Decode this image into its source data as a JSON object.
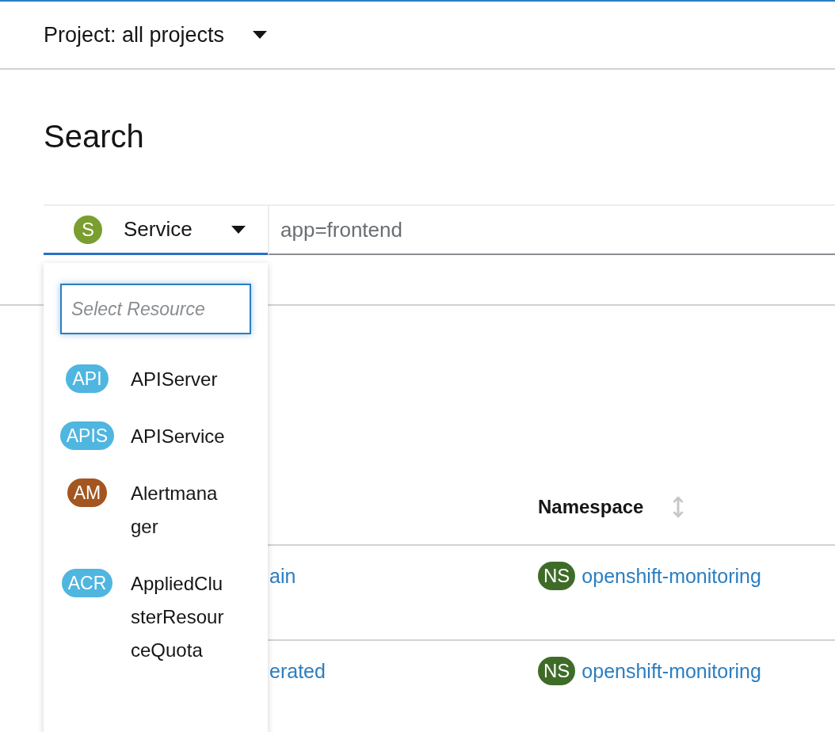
{
  "project_selector": {
    "label": "Project: all projects"
  },
  "page_title": "Search",
  "filter": {
    "resource": {
      "badge": "S",
      "label": "Service"
    },
    "query": {
      "value": "app=frontend"
    }
  },
  "resource_menu": {
    "search": {
      "placeholder": "Select Resource"
    },
    "items": [
      {
        "badge": "API",
        "color": "#4fb6e0",
        "label": "APIServer"
      },
      {
        "badge": "APIS",
        "color": "#4fb6e0",
        "label": "APIService"
      },
      {
        "badge": "AM",
        "color": "#a3561f",
        "label": "Alertmanager"
      },
      {
        "badge": "ACR",
        "color": "#4fb6e0",
        "label": "AppliedClusterResourceQuota"
      }
    ]
  },
  "table": {
    "column_2": {
      "label": "Namespace"
    },
    "rows": [
      {
        "column_1": "ain",
        "namespace_badge": "NS",
        "namespace": "openshift-monitoring"
      },
      {
        "column_1": "erated",
        "namespace_badge": "NS",
        "namespace": "openshift-monitoring"
      }
    ]
  }
}
